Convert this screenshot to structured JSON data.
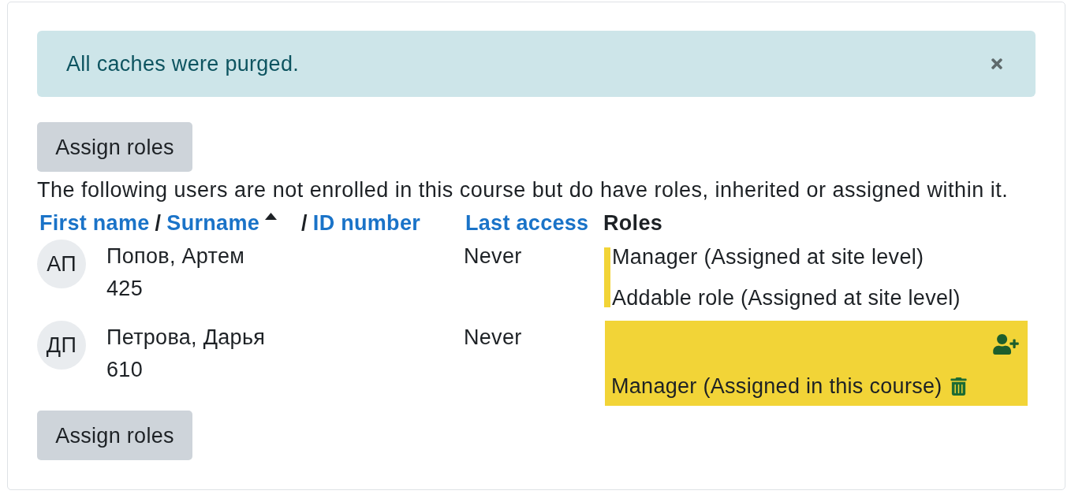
{
  "alert": {
    "message": "All caches were purged.",
    "dismissible": true
  },
  "top_button": {
    "label": "Assign roles"
  },
  "intro": "The following users are not enrolled in this course but do have roles, inherited or assigned within it.",
  "table": {
    "name_header": {
      "parts": [
        {
          "label": "First name",
          "kind": "link",
          "sorted": false
        },
        {
          "label": "/",
          "kind": "separator"
        },
        {
          "label": "Surname",
          "kind": "link",
          "sorted": true
        },
        {
          "label": "/",
          "kind": "separator"
        },
        {
          "label": "ID number",
          "kind": "link",
          "sorted": false
        }
      ]
    },
    "columns": [
      {
        "label": "Last access",
        "kind": "link"
      },
      {
        "label": "Roles",
        "kind": "plain"
      }
    ],
    "rows": [
      {
        "initials": "АП",
        "name": "Попов, Артем",
        "id_number": "425",
        "last_access": "Never",
        "edge_marked": true,
        "highlighted": false,
        "can_add": false,
        "roles": [
          {
            "label": "Manager (Assigned at site level)",
            "removable": false
          },
          {
            "label": "Addable role (Assigned at site level)",
            "removable": false
          }
        ]
      },
      {
        "initials": "ДП",
        "name": "Петрова, Дарья",
        "id_number": "610",
        "last_access": "Never",
        "edge_marked": false,
        "highlighted": true,
        "can_add": true,
        "roles": [
          {
            "label": "Manager (Assigned in this course)",
            "removable": true
          }
        ]
      }
    ]
  },
  "bottom_button": {
    "label": "Assign roles"
  }
}
